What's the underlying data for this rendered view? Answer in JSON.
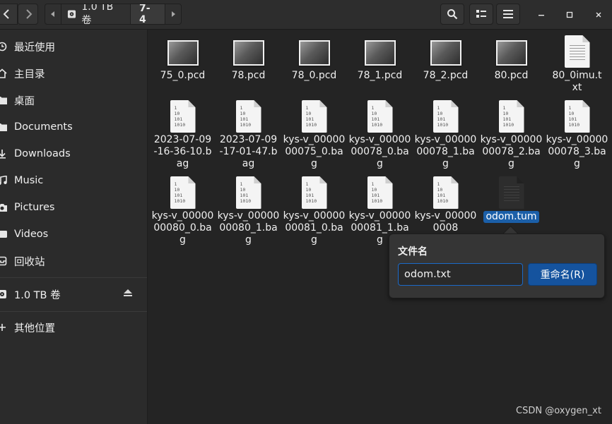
{
  "header": {
    "path": [
      "1.0 TB 卷",
      "7-4"
    ]
  },
  "sidebar": {
    "items": [
      {
        "label": "最近使用",
        "icon": "clock-icon"
      },
      {
        "label": "主目录",
        "icon": "home-icon"
      },
      {
        "label": "桌面",
        "icon": "folder-icon"
      },
      {
        "label": "Documents",
        "icon": "folder-icon"
      },
      {
        "label": "Downloads",
        "icon": "download-icon"
      },
      {
        "label": "Music",
        "icon": "music-icon"
      },
      {
        "label": "Pictures",
        "icon": "camera-icon"
      },
      {
        "label": "Videos",
        "icon": "video-icon"
      },
      {
        "label": "回收站",
        "icon": "trash-icon"
      }
    ],
    "volume": {
      "label": "1.0 TB 卷"
    },
    "other": {
      "label": "其他位置"
    }
  },
  "files": [
    {
      "name": "75_0.pcd",
      "kind": "pcd"
    },
    {
      "name": "78.pcd",
      "kind": "pcd"
    },
    {
      "name": "78_0.pcd",
      "kind": "pcd"
    },
    {
      "name": "78_1.pcd",
      "kind": "pcd"
    },
    {
      "name": "78_2.pcd",
      "kind": "pcd"
    },
    {
      "name": "80.pcd",
      "kind": "pcd"
    },
    {
      "name": "80_0imu.txt",
      "kind": "txt"
    },
    {
      "name": "2023-07-09-16-36-10.bag",
      "kind": "bag"
    },
    {
      "name": "2023-07-09-17-01-47.bag",
      "kind": "bag"
    },
    {
      "name": "kys-v_0000000075_0.bag",
      "kind": "bag"
    },
    {
      "name": "kys-v_0000000078_0.bag",
      "kind": "bag"
    },
    {
      "name": "kys-v_0000000078_1.bag",
      "kind": "bag"
    },
    {
      "name": "kys-v_0000000078_2.bag",
      "kind": "bag"
    },
    {
      "name": "kys-v_0000000078_3.bag",
      "kind": "bag"
    },
    {
      "name": "kys-v_0000000080_0.bag",
      "kind": "bag"
    },
    {
      "name": "kys-v_0000000080_1.bag",
      "kind": "bag"
    },
    {
      "name": "kys-v_0000000081_0.bag",
      "kind": "bag"
    },
    {
      "name": "kys-v_0000000081_1.bag",
      "kind": "bag"
    },
    {
      "name": "kys-v_000000008",
      "kind": "bag"
    },
    {
      "name": "odom.tum",
      "kind": "doc-selected"
    }
  ],
  "bag_icon_text": "1\n10\n101\n1010",
  "rename": {
    "title": "文件名",
    "value": "odom.txt",
    "button": "重命名(R)"
  },
  "watermark": "CSDN @oxygen_xt",
  "colors": {
    "accent": "#15539e",
    "background": "#242424",
    "sidebar": "#2b2b2b"
  }
}
